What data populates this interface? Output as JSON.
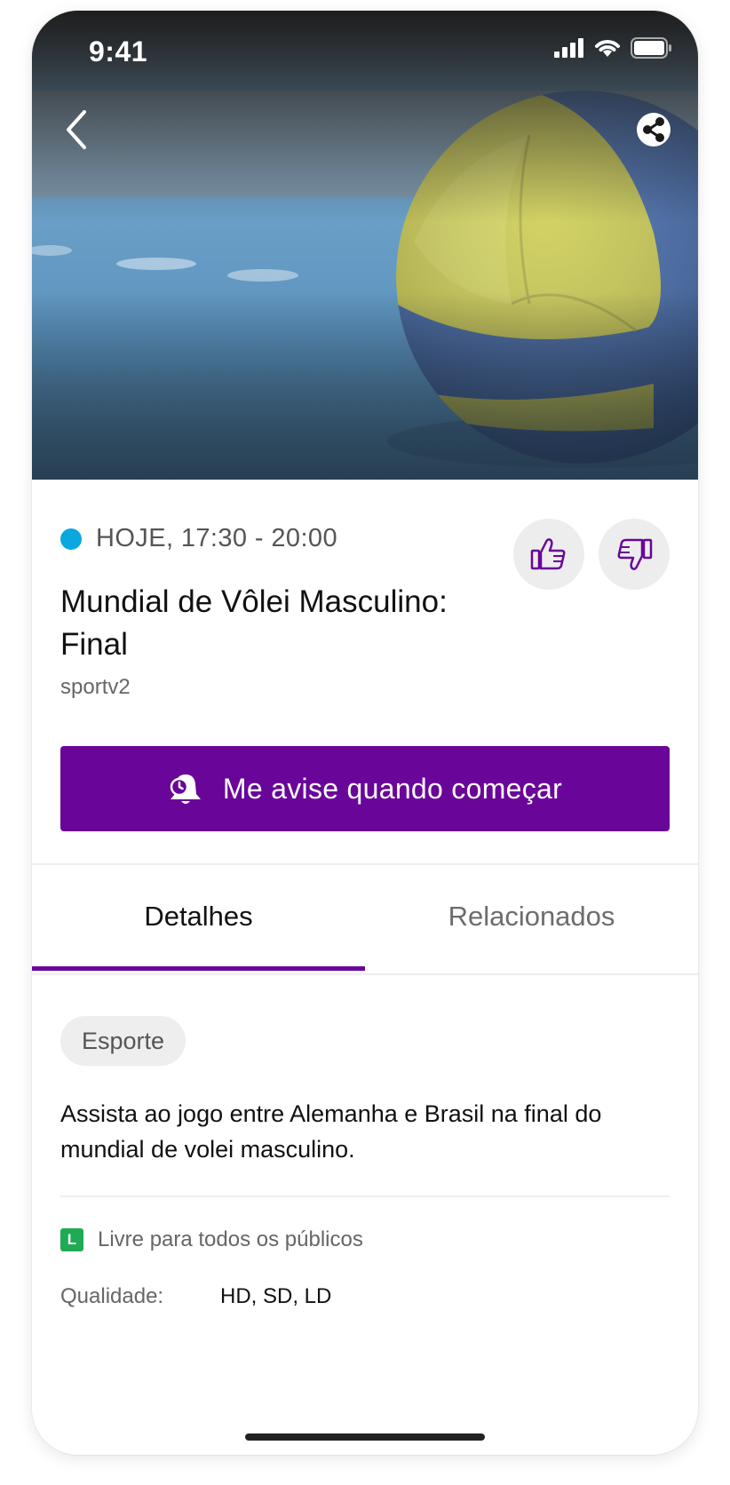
{
  "status_bar": {
    "time": "9:41"
  },
  "program": {
    "time_range": "HOJE, 17:30 - 20:00",
    "title": "Mundial de Vôlei Masculino: Final",
    "channel": "sportv2",
    "notify_label": "Me avise quando começar"
  },
  "tabs": [
    {
      "label": "Detalhes",
      "active": true
    },
    {
      "label": "Relacionados",
      "active": false
    }
  ],
  "details": {
    "category": "Esporte",
    "description": "Assista ao jogo entre Alemanha e Brasil na final do mundial de volei masculino.",
    "rating_badge": "L",
    "rating_text": "Livre para todos os públicos",
    "quality_label": "Qualidade:",
    "quality_value": "HD, SD, LD"
  },
  "colors": {
    "accent": "#6a0599",
    "live_dot": "#0aa8de",
    "rating_green": "#1faa55"
  },
  "icons": {
    "back": "chevron-left-icon",
    "share": "share-icon",
    "like": "thumbs-up-icon",
    "dislike": "thumbs-down-icon",
    "notify": "bell-clock-icon"
  }
}
